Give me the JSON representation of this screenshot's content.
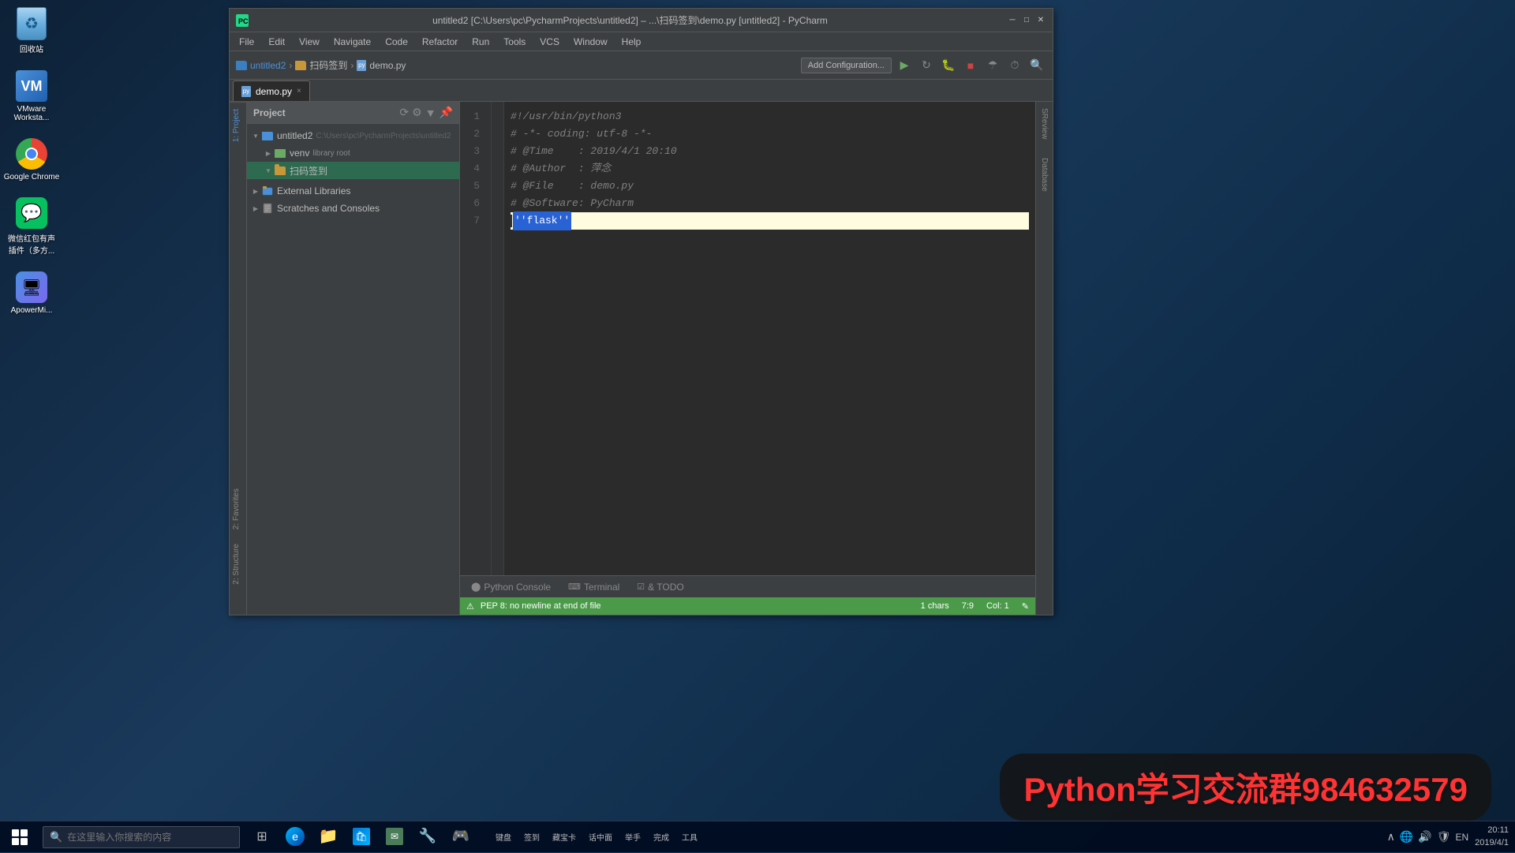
{
  "desktop": {
    "icons": [
      {
        "id": "recycle-bin",
        "label": "回收站",
        "type": "recycle"
      },
      {
        "id": "vmware",
        "label": "VMware\nWorksta...",
        "label2": "VMware Workstation",
        "type": "vmware"
      },
      {
        "id": "chrome",
        "label": "Google\nChrome",
        "type": "chrome"
      },
      {
        "id": "wechat",
        "label": "微信红包有声\n插件（多方...",
        "type": "wechat"
      },
      {
        "id": "apower",
        "label": "ApowerMi...",
        "type": "apower"
      }
    ]
  },
  "window": {
    "title": "untitled2 [C:\\Users\\pc\\PycharmProjects\\untitled2] – ...\\扫码签到\\demo.py [untitled2] - PyCharm",
    "breadcrumbs": [
      "untitled2",
      "扫码签到",
      "demo.py"
    ],
    "project_label": "Project",
    "tree": [
      {
        "id": "untitled2",
        "label": "untitled2",
        "path": "C:\\Users\\pc\\PycharmProjects\\untitled2",
        "indent": 0,
        "type": "project",
        "expanded": true
      },
      {
        "id": "venv",
        "label": "venv",
        "suffix": "library root",
        "indent": 1,
        "type": "venv",
        "expanded": false
      },
      {
        "id": "scanfolder",
        "label": "扫码签到",
        "indent": 1,
        "type": "folder",
        "expanded": true,
        "selected": true
      },
      {
        "id": "external",
        "label": "External Libraries",
        "indent": 0,
        "type": "library",
        "expanded": false
      },
      {
        "id": "scratches",
        "label": "Scratches and Consoles",
        "indent": 0,
        "type": "scratches",
        "expanded": false
      }
    ],
    "tab": "demo.py",
    "code_lines": [
      {
        "num": 1,
        "content": "#!/usr/bin/python3",
        "type": "comment"
      },
      {
        "num": 2,
        "content": "# -*- coding: utf-8 -*-",
        "type": "comment"
      },
      {
        "num": 3,
        "content": "# @Time    : 2019/4/1 20:10",
        "type": "comment"
      },
      {
        "num": 4,
        "content": "# @Author  : 萍念",
        "type": "comment"
      },
      {
        "num": 5,
        "content": "# @File    : demo.py",
        "type": "comment"
      },
      {
        "num": 6,
        "content": "# @Software: PyCharm",
        "type": "comment"
      },
      {
        "num": 7,
        "content": "''flask''",
        "type": "string-selected",
        "highlighted": true
      }
    ],
    "add_config_label": "Add Configuration...",
    "menu_items": [
      "File",
      "Edit",
      "View",
      "Navigate",
      "Code",
      "Refactor",
      "Run",
      "Tools",
      "VCS",
      "Window",
      "Help"
    ],
    "bottom_tabs": [
      {
        "id": "python-console",
        "icon": "⬤",
        "label": "Python Console"
      },
      {
        "id": "terminal",
        "icon": ">_",
        "label": "Terminal"
      },
      {
        "id": "todo",
        "icon": "☑",
        "label": "& TODO"
      }
    ],
    "status_bar": {
      "warning": "⚠ PEP 8: no newline at end of file",
      "position": "1 chars    7:9    Col: 1 ✎"
    },
    "right_tabs": [
      "SReview",
      "Database"
    ],
    "left_panel_tabs": [
      "1: Project",
      "2: Favorites",
      "2: Structure"
    ]
  },
  "watermark": {
    "text": "Python学习交流群984632579"
  },
  "taskbar": {
    "search_placeholder": "在这里输入你搜索的内容",
    "time": "20:11",
    "date": "2019/4/1",
    "apps": [
      {
        "id": "start",
        "type": "start"
      },
      {
        "id": "task-view",
        "type": "taskview"
      },
      {
        "id": "edge",
        "type": "edge"
      },
      {
        "id": "explorer",
        "type": "explorer"
      },
      {
        "id": "store",
        "type": "store"
      },
      {
        "id": "unknown1",
        "type": "icon"
      },
      {
        "id": "unknown2",
        "type": "icon"
      },
      {
        "id": "unknown3",
        "type": "icon"
      }
    ],
    "right_labels": [
      "键盘",
      "签到",
      "藏宝卡",
      "话中面",
      "举手",
      "完成",
      "工具"
    ],
    "tray_icons": [
      "^",
      "网络",
      "声音",
      "输入法",
      "EN"
    ]
  }
}
